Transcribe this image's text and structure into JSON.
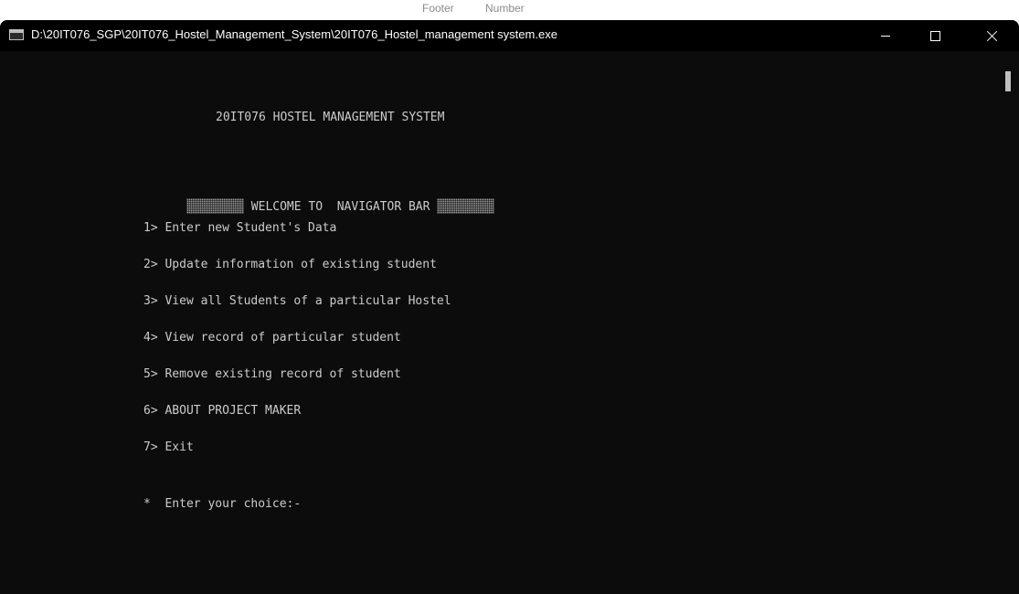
{
  "background_window": {
    "snippet_a": "Footer",
    "snippet_b": "Number"
  },
  "window": {
    "title": "D:\\20IT076_SGP\\20IT076_Hostel_Management_System\\20IT076_Hostel_management system.exe",
    "icon": "console-app-icon",
    "controls": {
      "minimize": "minimize-icon",
      "maximize": "maximize-icon",
      "close": "close-icon"
    }
  },
  "console": {
    "heading": "20IT076 HOSTEL MANAGEMENT SYSTEM",
    "welcome": "WELCOME TO  NAVIGATOR BAR",
    "menu": [
      "1> Enter new Student's Data",
      "2> Update information of existing student",
      "3> View all Students of a particular Hostel",
      "4> View record of particular student",
      "5> Remove existing record of student",
      "6> ABOUT PROJECT MAKER",
      "7> Exit"
    ],
    "prompt": "*  Enter your choice:-"
  },
  "colors": {
    "console_bg": "#0c0c0c",
    "console_text": "#cccccc",
    "titlebar_bg": "#000000"
  }
}
